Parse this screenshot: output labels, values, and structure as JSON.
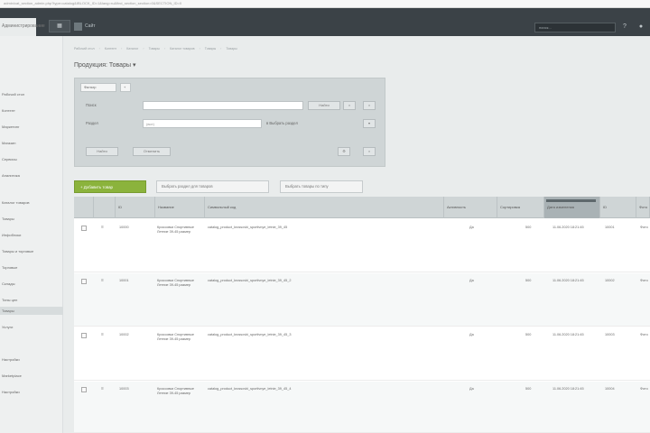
{
  "browser": {
    "url": "admin/cat_section_admin.php?type=catalog&IBLOCK_ID=1&lang=ru&find_section_section=0&SECTION_ID=0"
  },
  "header": {
    "active_tab": "Администрирование",
    "site_label": "Сайт",
    "search_placeholder": "поиск...",
    "icons": [
      "apps-icon",
      "help-icon",
      "user-icon"
    ]
  },
  "sidebar": {
    "items": [
      "Рабочий стол",
      "Контент",
      "Маркетинг",
      "Магазин",
      "Сервисы",
      "Аналитика",
      "Каталог товаров",
      "Товары",
      "Инфоблоки",
      "Товары и торговые",
      "Торговые",
      "Склады",
      "Типы цен",
      "Товары",
      "Услуги",
      "Настройки",
      "Marketplace",
      "Настройки"
    ],
    "active_index": 13
  },
  "breadcrumb": [
    "Рабочий стол",
    "Контент",
    "Каталог",
    "Товары",
    "Каталог товаров",
    "Товары",
    "Товары"
  ],
  "page_title": "Продукция: Товары",
  "filter": {
    "tabs": [
      "Фильтр",
      "+"
    ],
    "name_label": "Поиск",
    "search_button": "Найти",
    "sort_label": "Раздел",
    "sort_value": "(все)",
    "select_label": "в Выбрать раздел",
    "find_button": "Найти",
    "cancel_button": "Отменить"
  },
  "actions": {
    "add_button": "+ Добавить товар",
    "btn2": "Выбрать раздел для товаров",
    "btn3": "Выбрать товары по типу"
  },
  "table": {
    "columns": [
      "",
      "ID",
      "Тип",
      "Название",
      "Символьный код",
      "Активность",
      "Сортировка",
      "Дата изменения",
      "ID",
      "Фото"
    ],
    "rows": [
      {
        "id": "10000",
        "name": "Кроссовки Спортивные Летние 39-45 размер",
        "code": "catalog_product_krossovki_sportivnye_letnie_39_45",
        "active": "Да",
        "sort": "500",
        "date": "11.06.2020 18:21:45",
        "xml": "10001",
        "photo": "Фото"
      },
      {
        "id": "10001",
        "name": "Кроссовки Спортивные Летние 39-45 размер",
        "code": "catalog_product_krossovki_sportivnye_letnie_39_45_2",
        "active": "Да",
        "sort": "500",
        "date": "11.06.2020 18:21:45",
        "xml": "10002",
        "photo": "Фото"
      },
      {
        "id": "10002",
        "name": "Кроссовки Спортивные Летние 39-45 размер",
        "code": "catalog_product_krossovki_sportivnye_letnie_39_45_3",
        "active": "Да",
        "sort": "500",
        "date": "11.06.2020 18:21:45",
        "xml": "10003",
        "photo": "Фото"
      },
      {
        "id": "10003",
        "name": "Кроссовки Спортивные Летние 39-45 размер",
        "code": "catalog_product_krossovki_sportivnye_letnie_39_45_4",
        "active": "Да",
        "sort": "500",
        "date": "11.06.2020 18:21:45",
        "xml": "10004",
        "photo": "Фото"
      }
    ]
  },
  "colors": {
    "accent": "#8bb33c",
    "topbar": "#3b4247"
  }
}
